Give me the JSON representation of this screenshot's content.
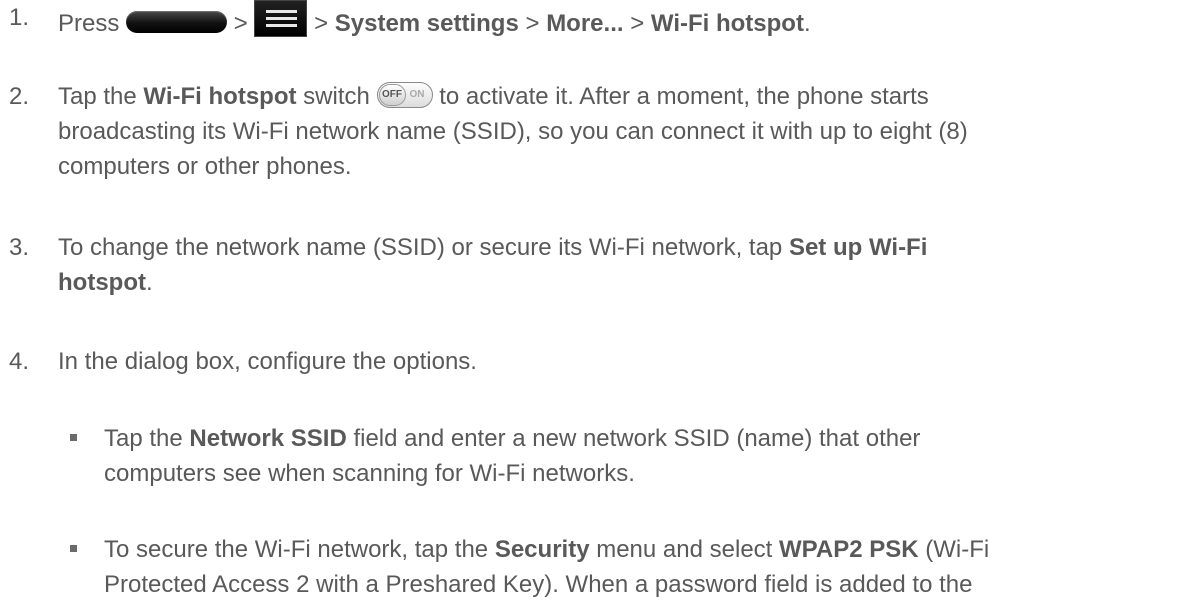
{
  "steps": [
    {
      "num": "1.",
      "press": "Press",
      "sep": ">",
      "system_settings": "System settings",
      "more": "More...",
      "wifi_hotspot": "Wi-Fi hotspot",
      "period": "."
    },
    {
      "num": "2.",
      "pre": "Tap the",
      "bold": "Wi-Fi hotspot",
      "mid": "switch",
      "post_line1": "to activate it. After a moment, the phone starts",
      "line2": "broadcasting its Wi-Fi network name (SSID), so you can connect it with up to eight (8)",
      "line3": "computers or other phones."
    },
    {
      "num": "3.",
      "line1": "To change the network name (SSID) or secure its Wi-Fi network, tap",
      "bold1": "Set up Wi-Fi",
      "bold2": "hotspot",
      "period": "."
    },
    {
      "num": "4.",
      "text": "In the dialog box, configure the options."
    }
  ],
  "bullets": [
    {
      "pre": "Tap the",
      "bold": "Network SSID",
      "post": "field and enter a new network SSID (name) that other",
      "line2": "computers see when scanning for Wi-Fi networks."
    },
    {
      "pre": "To secure the Wi-Fi network, tap the",
      "bold1": "Security",
      "mid": "menu and select",
      "bold2": "WPAP2 PSK",
      "post": "(Wi-Fi",
      "line2": "Protected Access 2 with a Preshared Key). When a password field is added to the"
    }
  ],
  "toggle": {
    "off_label": "OFF",
    "on_label": "ON"
  },
  "icons": {
    "home": "home-key-icon",
    "menu": "menu-key-icon",
    "switch": "toggle-switch-icon"
  }
}
